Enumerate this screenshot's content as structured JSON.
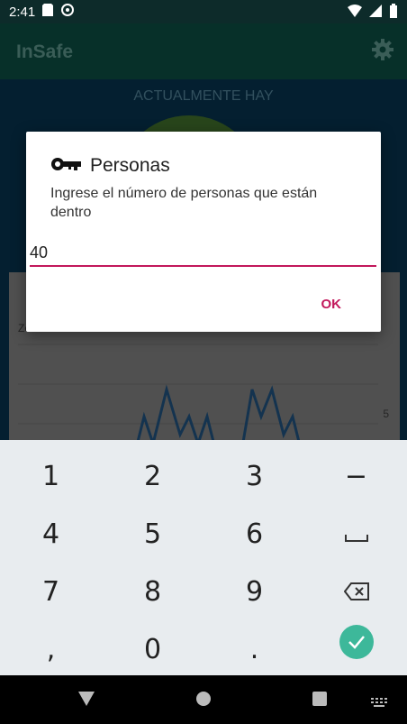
{
  "status_bar": {
    "time": "2:41"
  },
  "app": {
    "title": "InSafe"
  },
  "background": {
    "actualmente_label": "ACTUALMENTE HAY",
    "chart_label_left": "Ze",
    "chart_label_right": "5"
  },
  "dialog": {
    "title": "Personas",
    "message": "Ingrese el número de personas que están dentro",
    "input_value": "40",
    "ok_label": "OK"
  },
  "keyboard": {
    "rows": [
      [
        "1",
        "2",
        "3",
        "−"
      ],
      [
        "4",
        "5",
        "6",
        "␣"
      ],
      [
        "7",
        "8",
        "9",
        "⌫"
      ],
      [
        ",",
        "0",
        ".",
        "✓"
      ]
    ]
  },
  "colors": {
    "accent": "#c2185b",
    "appbar": "#0b4a3f",
    "enter": "#3db89a"
  }
}
